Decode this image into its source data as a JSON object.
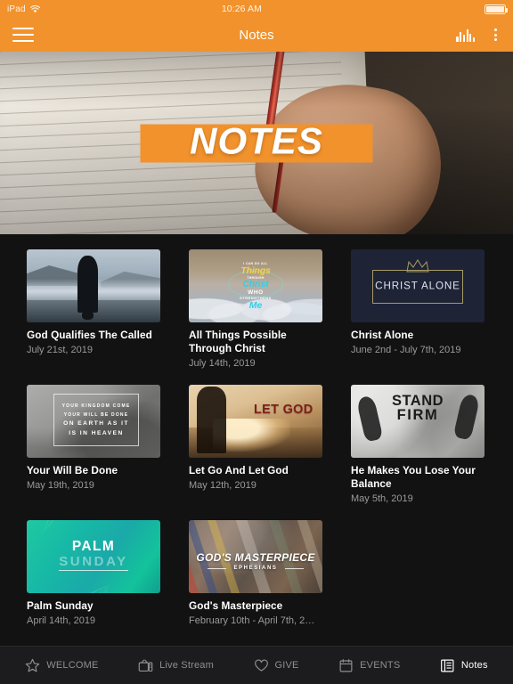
{
  "status_bar": {
    "device": "iPad",
    "wifi_icon": "wifi-icon",
    "time": "10:26 AM",
    "battery_icon": "battery-full-icon"
  },
  "nav_bar": {
    "menu_icon": "hamburger-menu-icon",
    "title": "Notes",
    "equalizer_icon": "audio-equalizer-icon",
    "overflow_icon": "kebab-menu-icon",
    "background_color": "#F2922C"
  },
  "hero": {
    "banner_text": "NOTES",
    "banner_color": "#F2922C",
    "image_description": "hand-writing-in-notebook-photo"
  },
  "grid": {
    "cards": [
      {
        "title": "God Qualifies The Called",
        "date": "July 21st, 2019",
        "thumb": "man-standing-by-misty-lake"
      },
      {
        "title": "All Things Possible Through Christ",
        "date": "July 14th, 2019",
        "thumb": "clouds-all-things-possible",
        "art": {
          "l1": "I CAN DO ALL",
          "l2": "Things",
          "l3": "THROUGH",
          "l4": "Christ",
          "l5": "WHO",
          "l6": "STRENGTHENS",
          "l7": "Me"
        }
      },
      {
        "title": "Christ Alone",
        "date": "June 2nd - July 7th, 2019",
        "thumb": "christ-alone-crown-navy",
        "art": {
          "label": "CHRIST ALONE"
        }
      },
      {
        "title": "Your Will Be Done",
        "date": "May 19th, 2019",
        "thumb": "your-kingdom-come-grayscale",
        "art": {
          "l1": "YOUR KINGDOM COME",
          "l2": "YOUR WILL BE DONE",
          "l3": "ON EARTH AS IT",
          "l4": "IS IN HEAVEN"
        }
      },
      {
        "title": "Let Go And Let God",
        "date": "May 12th, 2019",
        "thumb": "let-go-sunset-field",
        "art": {
          "label": "LET GOD"
        }
      },
      {
        "title": "He Makes You Lose Your Balance",
        "date": "May 5th, 2019",
        "thumb": "stand-firm-bootprints",
        "art": {
          "l1": "STAND",
          "l2": "FIRM"
        }
      },
      {
        "title": "Palm Sunday",
        "date": "April 14th, 2019",
        "thumb": "palm-sunday-teal",
        "art": {
          "l1": "PALM",
          "l2": "SUNDAY"
        }
      },
      {
        "title": "God's Masterpiece",
        "date": "February 10th - April 7th, 2…",
        "thumb": "gods-masterpiece-paintbrushes",
        "art": {
          "l1": "GOD'S MASTERPIECE",
          "l2": "EPHESIANS"
        }
      }
    ]
  },
  "tab_bar": {
    "tabs": [
      {
        "label": "WELCOME",
        "icon": "star-icon",
        "active": false
      },
      {
        "label": "Live Stream",
        "icon": "tv-icon",
        "active": false
      },
      {
        "label": "GIVE",
        "icon": "heart-icon",
        "active": false
      },
      {
        "label": "EVENTS",
        "icon": "calendar-icon",
        "active": false
      },
      {
        "label": "Notes",
        "icon": "notebook-icon",
        "active": true
      }
    ]
  }
}
